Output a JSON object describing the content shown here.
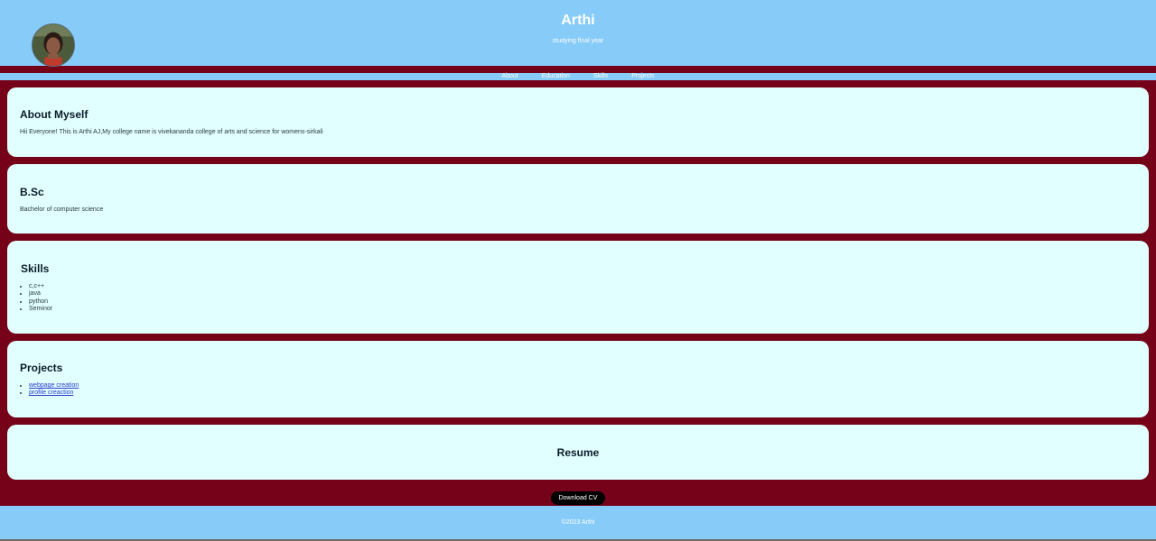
{
  "header": {
    "name": "Arthi",
    "tagline": "studying final year"
  },
  "nav": {
    "items": [
      "About",
      "Education",
      "Skills",
      "Projects"
    ]
  },
  "about": {
    "title": "About Myself",
    "text": "Hii Everyone! This is Arthi AJ,My college name is vivekananda college of arts and science for womens-sirkali"
  },
  "education": {
    "title": "B.Sc",
    "text": "Bachelor of computer science"
  },
  "skills": {
    "title": "Skills",
    "items": [
      "c,c++",
      "java",
      "python",
      "Seminor"
    ]
  },
  "projects": {
    "title": "Projects",
    "items": [
      "webpage creation",
      "profile creaction"
    ]
  },
  "resume": {
    "title": "Resume",
    "download_label": "Download CV"
  },
  "footer": {
    "text": "©2023 Arthi"
  },
  "colors": {
    "header_bg": "#87cbf8",
    "page_bg": "#76021a",
    "card_bg": "#e0fffe",
    "button_bg": "#000000"
  }
}
